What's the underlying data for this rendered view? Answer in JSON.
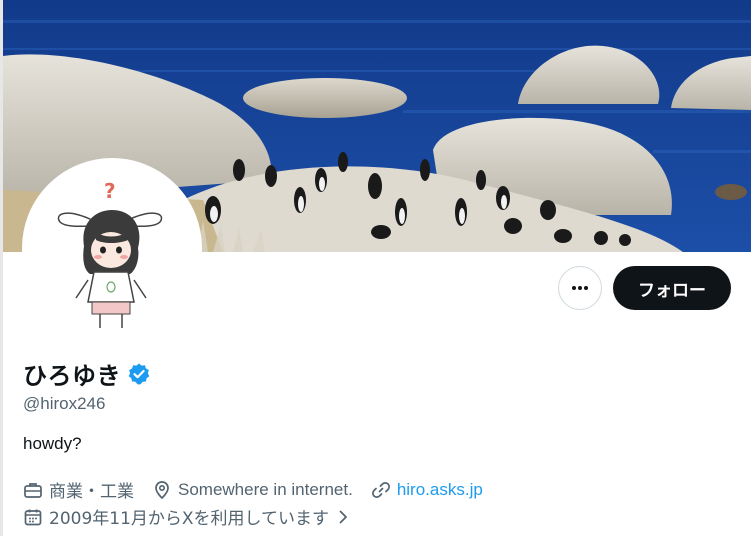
{
  "profile": {
    "display_name": "ひろゆき",
    "handle": "@hirox246",
    "bio": "howdy?",
    "verified": true,
    "verified_color": "#1d9bf0"
  },
  "actions": {
    "follow_label": "フォロー",
    "more_icon": "more-horizontal-icon"
  },
  "meta": {
    "profession": "商業・工業",
    "profession_icon": "briefcase-icon",
    "location": "Somewhere in internet.",
    "location_icon": "location-pin-icon",
    "website": "hiro.asks.jp",
    "website_icon": "link-icon",
    "joined": "2009年11月からXを利用しています",
    "joined_icon": "calendar-icon"
  },
  "colors": {
    "accent": "#1d9bf0",
    "text_primary": "#0f1419",
    "text_secondary": "#536471",
    "button_dark": "#0f1419"
  }
}
